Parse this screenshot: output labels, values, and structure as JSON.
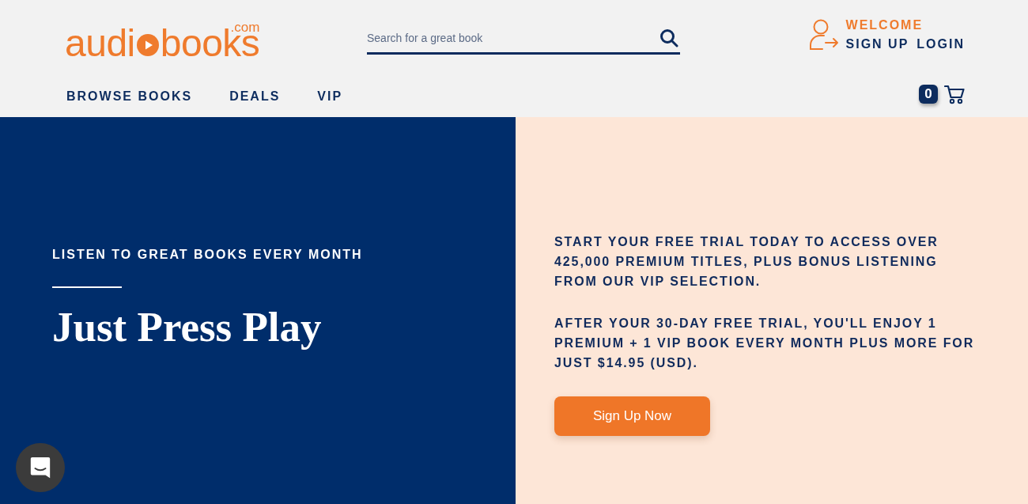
{
  "header": {
    "logo": {
      "start": "audi",
      "end": "books",
      "domain": ".com"
    },
    "search": {
      "placeholder": "Search for a great book"
    },
    "account": {
      "greeting": "WELCOME",
      "links": [
        "SIGN UP",
        "LOGIN"
      ]
    },
    "nav": [
      "BROWSE BOOKS",
      "DEALS",
      "VIP"
    ],
    "cart": {
      "count": "0"
    }
  },
  "hero": {
    "eyebrow": "LISTEN TO GREAT BOOKS EVERY MONTH",
    "title": "Just Press Play",
    "paragraphs": [
      "START YOUR FREE TRIAL TODAY TO ACCESS OVER 425,000 PREMIUM TITLES, PLUS BONUS LISTENING FROM OUR VIP SELECTION.",
      "AFTER YOUR 30-DAY FREE TRIAL, YOU'LL ENJOY 1 PREMIUM + 1 VIP BOOK EVERY MONTH PLUS MORE FOR JUST $14.95 (USD)."
    ],
    "button": "Sign Up Now"
  }
}
